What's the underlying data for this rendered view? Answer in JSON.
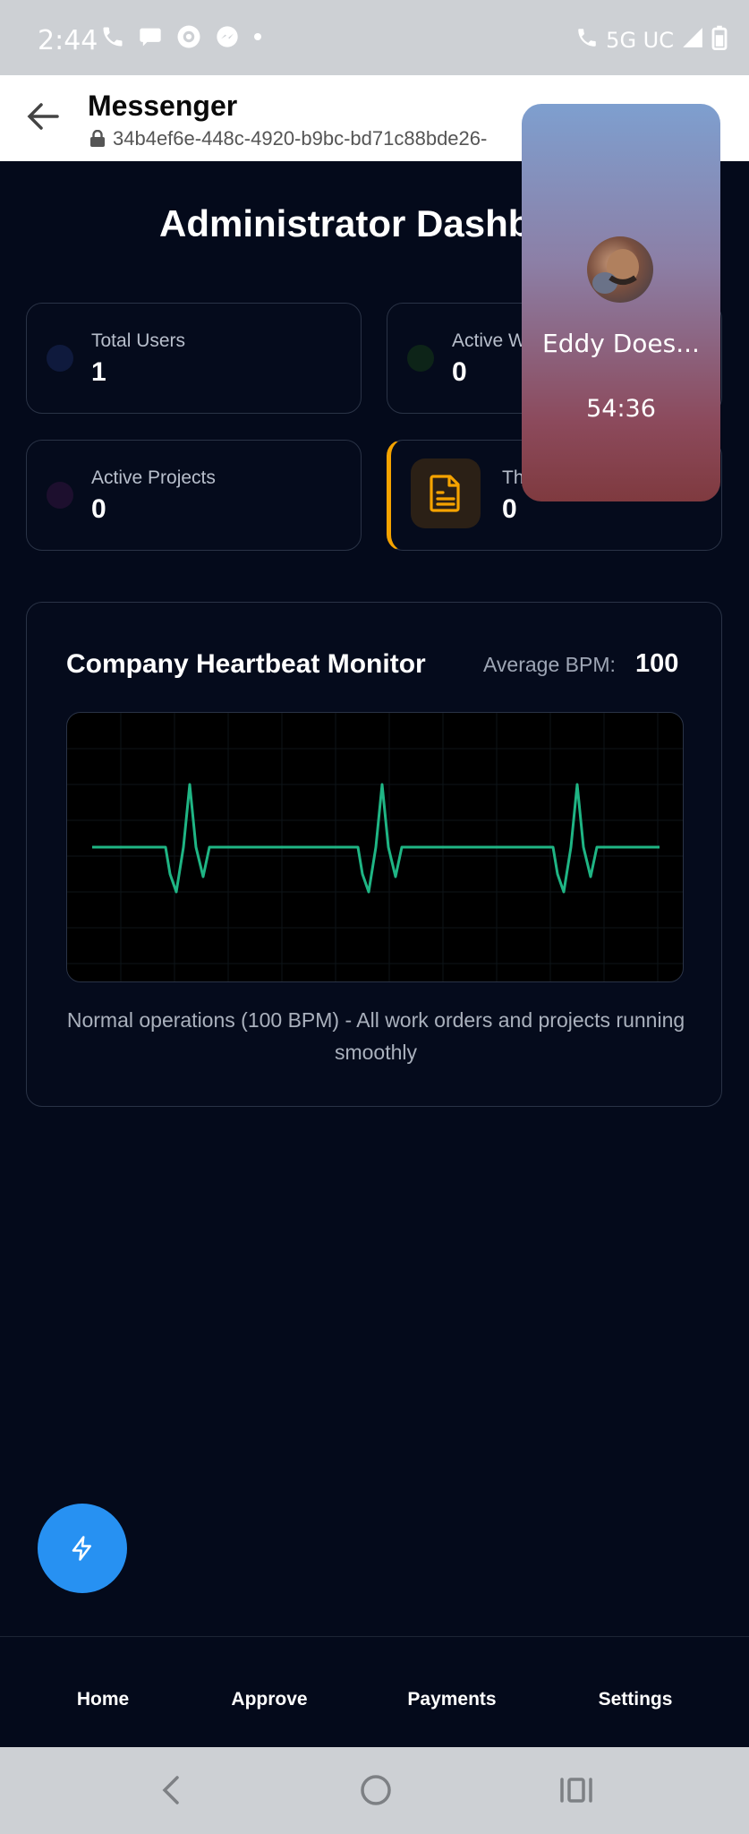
{
  "status_bar": {
    "time": "2:44",
    "network": "5G UC"
  },
  "app_bar": {
    "title": "Messenger",
    "url": "34b4ef6e-448c-4920-b9bc-bd71c88bde26-"
  },
  "dashboard": {
    "title": "Administrator Dashbo",
    "stats": [
      {
        "label": "Total Users",
        "value": "1",
        "dot_color": "#0f1a3d"
      },
      {
        "label": "Active W",
        "value": "0",
        "dot_color": "#0d2418"
      },
      {
        "label": "Active Projects",
        "value": "0",
        "dot_color": "#1d0f2e"
      },
      {
        "label": "Th",
        "value": "0",
        "icon": "document-icon",
        "accent_color": "#f5a300"
      }
    ]
  },
  "heartbeat": {
    "title": "Company Heartbeat Monitor",
    "avg_label": "Average BPM:",
    "avg_value": "100",
    "note": "Normal operations (100 BPM) - All work orders and projects running smoothly",
    "line_color": "#1fb584"
  },
  "call_bubble": {
    "caller": "Eddy Does...",
    "duration": "54:36"
  },
  "fab": {
    "icon": "lightning-icon",
    "color": "#2791f2"
  },
  "bottom_nav": [
    "Home",
    "Approve",
    "Payments",
    "Settings"
  ]
}
